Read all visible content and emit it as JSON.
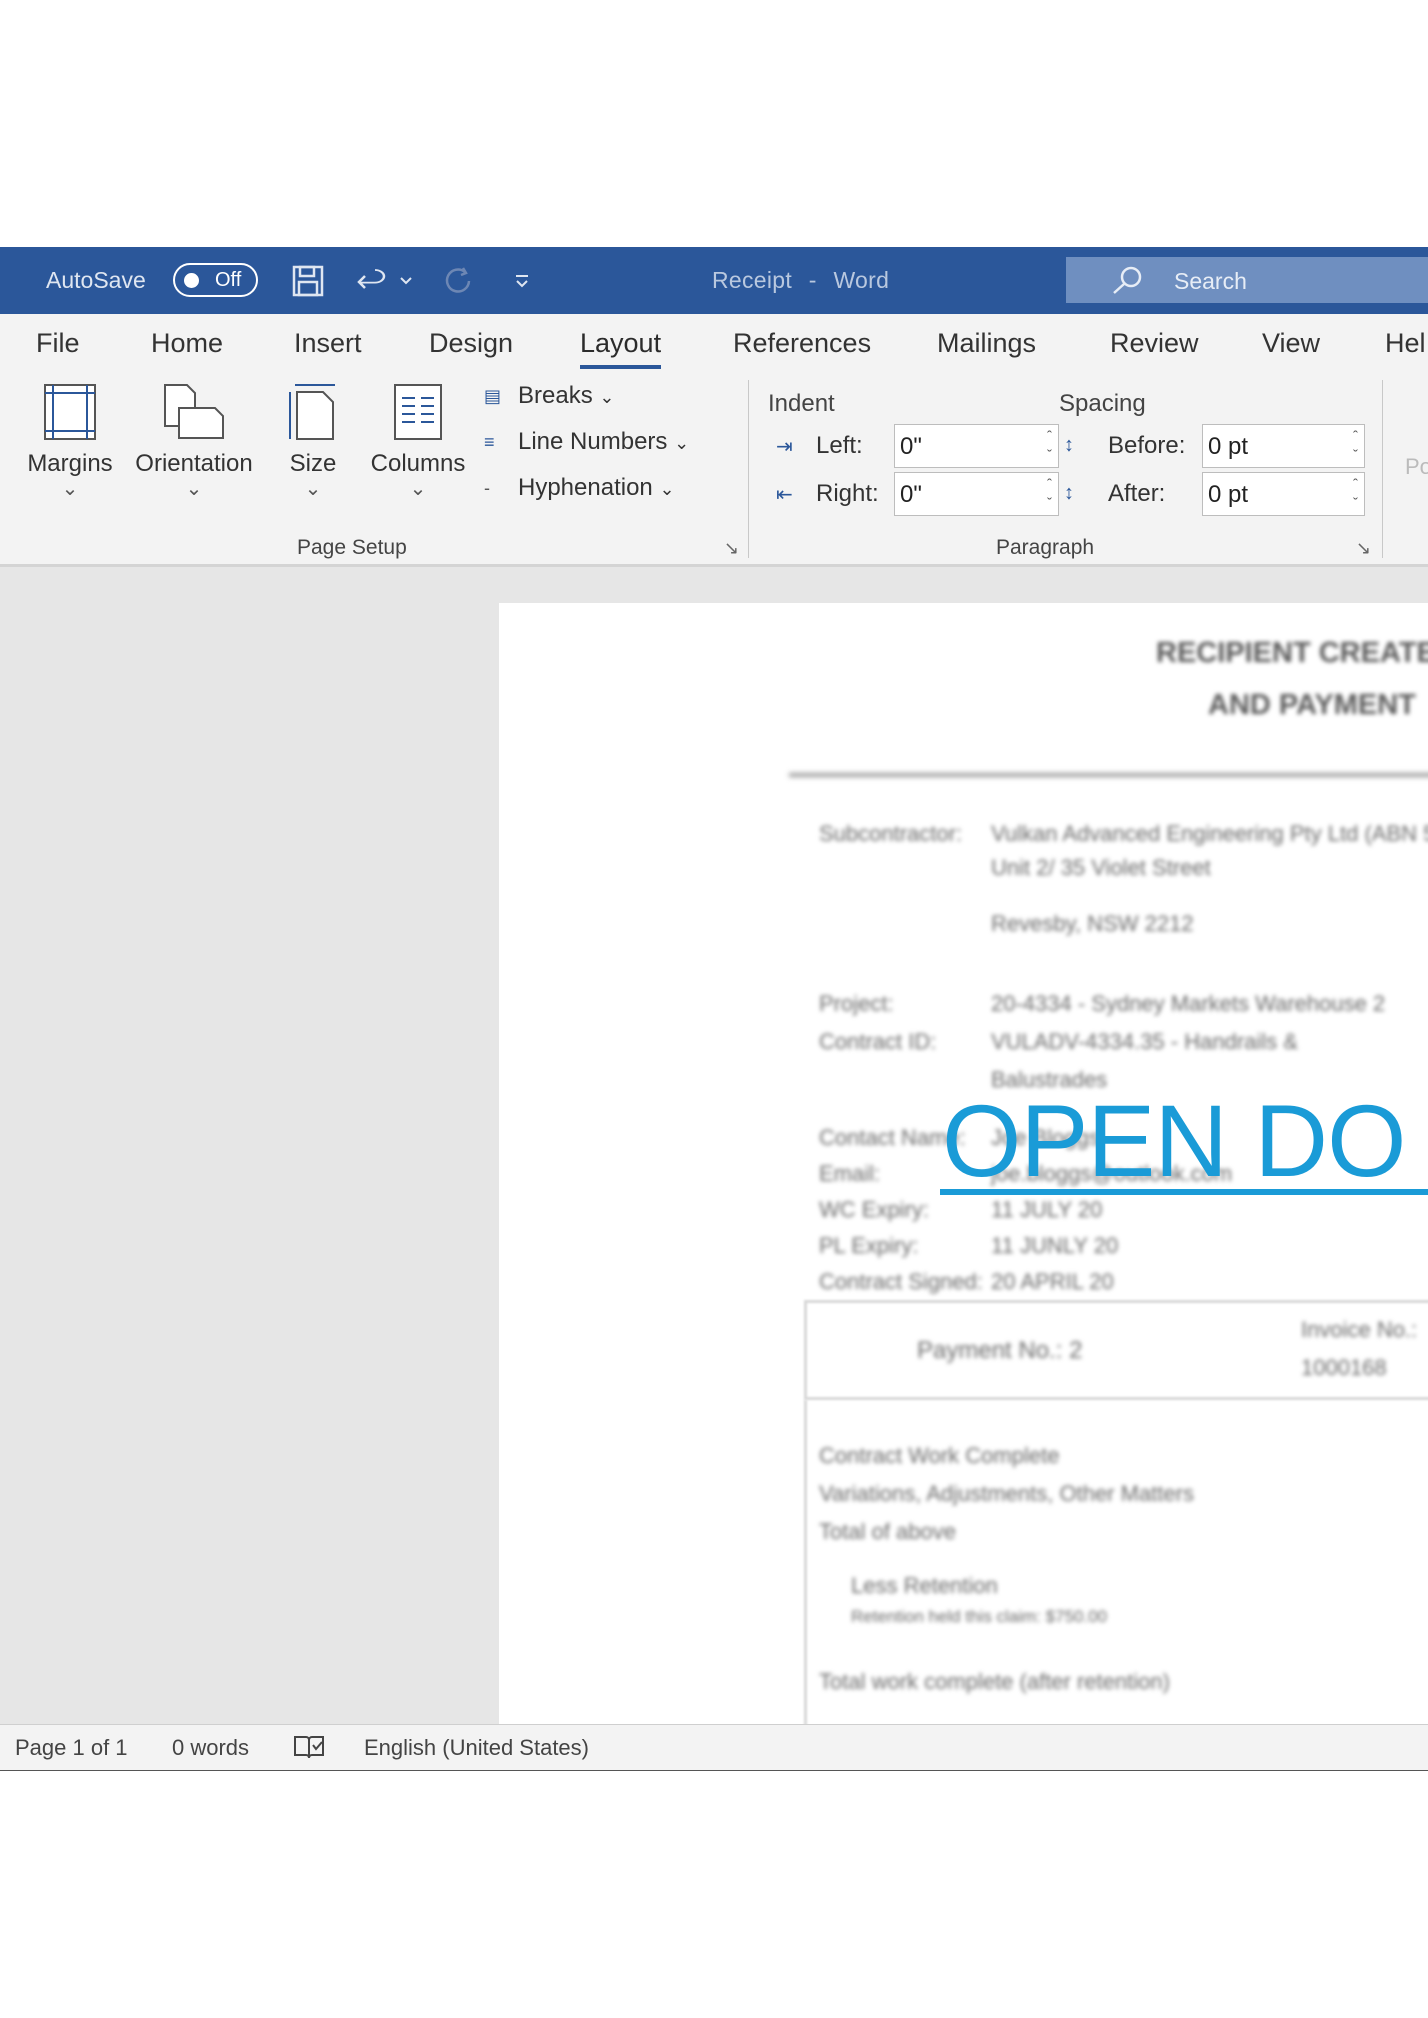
{
  "titlebar": {
    "autosave_label": "AutoSave",
    "autosave_state": "Off",
    "doc_name": "Receipt",
    "separator": "-",
    "app_name": "Word",
    "search_placeholder": "Search",
    "bg_color": "#2b579a"
  },
  "tabs": [
    "File",
    "Home",
    "Insert",
    "Design",
    "Layout",
    "References",
    "Mailings",
    "Review",
    "View",
    "Hel"
  ],
  "active_tab": "Layout",
  "page_setup": {
    "margins": "Margins",
    "orientation": "Orientation",
    "size": "Size",
    "columns": "Columns",
    "breaks": "Breaks",
    "line_numbers": "Line Numbers",
    "hyphenation": "Hyphenation",
    "group_label": "Page Setup"
  },
  "paragraph": {
    "indent_header": "Indent",
    "spacing_header": "Spacing",
    "left_label": "Left:",
    "left_value": "0\"",
    "right_label": "Right:",
    "right_value": "0\"",
    "before_label": "Before:",
    "before_value": "0 pt",
    "after_label": "After:",
    "after_value": "0 pt",
    "group_label": "Paragraph"
  },
  "ribbon_cut_label": "Po",
  "document": {
    "heading1": "RECIPIENT CREATE",
    "heading2": "AND PAYMENT",
    "subcontractor_label": "Subcontractor:",
    "subcontractor_line1": "Vulkan Advanced Engineering Pty Ltd (ABN 5",
    "subcontractor_line2": "Unit 2/ 35 Violet Street",
    "subcontractor_line3": "Revesby, NSW 2212",
    "project_label": "Project:",
    "project_value": "20-4334 - Sydney Markets Warehouse 2",
    "contract_id_label": "Contract ID:",
    "contract_id_value": "VULADV-4334.35 - Handrails &",
    "contract_id_value2": "Balustrades",
    "contact_name_label": "Contact Name:",
    "contact_name_value": "Joe Bloggs",
    "email_label": "Email:",
    "email_value": "joe.bloggs@outlook.com",
    "wc_expiry_label": "WC Expiry:",
    "wc_expiry_value": "11 JULY 20",
    "pl_expiry_label": "PL Expiry:",
    "pl_expiry_value": "11 JUNLY 20",
    "contract_signed_label": "Contract Signed:",
    "contract_signed_value": "20 APRIL 20",
    "payment_no": "Payment No.: 2",
    "invoice_no_label": "Invoice No.:",
    "invoice_no_value": "1000168",
    "row1": "Contract Work Complete",
    "row2": "Variations, Adjustments, Other Matters",
    "row3": "Total of above",
    "row4": "Less Retention",
    "row4_sub": "Retention held this claim: $750.00",
    "row5": "Total work complete (after retention)",
    "overlay_text": "OPEN DO",
    "overlay_color": "#1a9bd7"
  },
  "statusbar": {
    "page": "Page 1 of 1",
    "words": "0 words",
    "language": "English (United States)"
  }
}
